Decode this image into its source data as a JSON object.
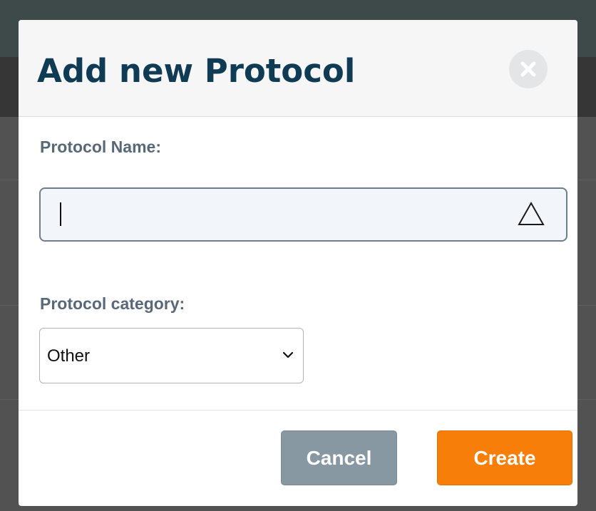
{
  "modal": {
    "title": "Add new Protocol",
    "protocol_name": {
      "label": "Protocol Name:",
      "value": "",
      "placeholder": ""
    },
    "protocol_category": {
      "label": "Protocol category:",
      "selected": "Other"
    },
    "buttons": {
      "cancel_label": "Cancel",
      "create_label": "Create"
    }
  },
  "icons": {
    "close": "close-icon",
    "name_field": "warning-triangle-icon",
    "select": "chevron-down-icon"
  },
  "colors": {
    "title": "#0f3b54",
    "label": "#596878",
    "create_button": "#f87e0a",
    "cancel_button": "#8898a2",
    "input_background": "#f2f6fa"
  }
}
